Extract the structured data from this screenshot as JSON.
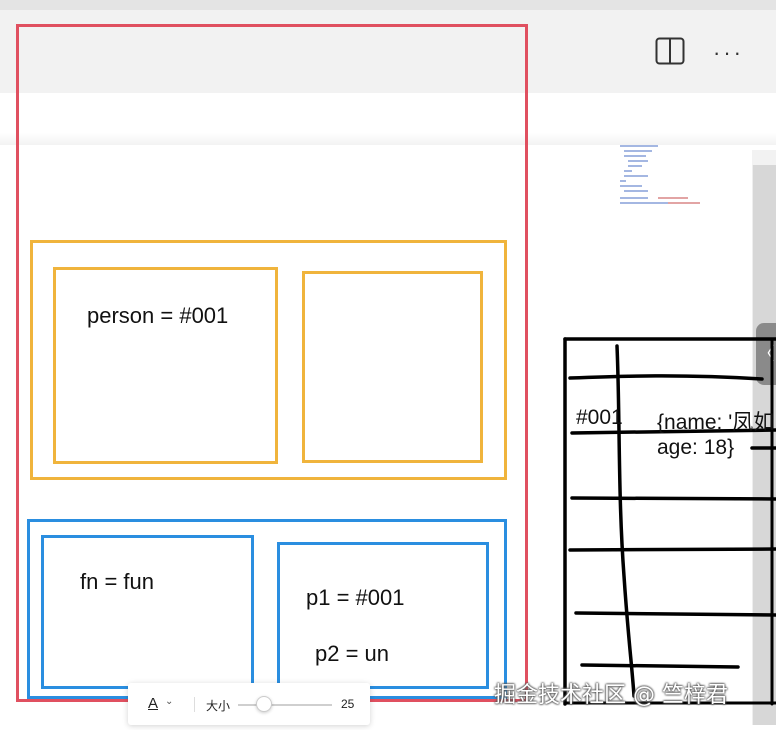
{
  "toolbar": {
    "split_view_icon": "split-view-icon",
    "more_icon": "more-icon",
    "more_glyph": "···"
  },
  "collapse_tab": {
    "glyph": "〈"
  },
  "stack": {
    "global_scope": {
      "left": {
        "text": "person = #001"
      },
      "right": {
        "text": ""
      }
    },
    "function_scope": {
      "left": {
        "text": "fn = fun"
      },
      "right": {
        "line1": "p1 = #001",
        "line2": "p2 = un"
      }
    }
  },
  "heap": {
    "address": "#001",
    "object_line1": "{name: '凤如",
    "object_line2": "age: 18}"
  },
  "font_toolbar": {
    "font_glyph": "A",
    "caret": "⌄",
    "size_label": "大小",
    "size_value": "25",
    "slider_fraction": 0.25
  },
  "watermark": "掘金技术社区 @ 竺梓君",
  "colors": {
    "frame": "#e05060",
    "global": "#f0b43c",
    "function": "#2a8ee0",
    "heap": "#000000"
  }
}
